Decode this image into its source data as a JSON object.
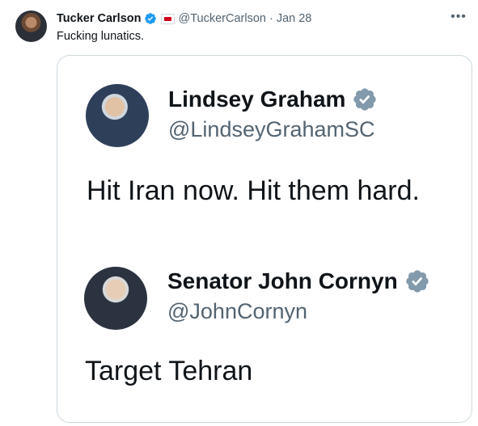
{
  "tweet": {
    "display_name": "Tucker Carlson",
    "handle": "@TuckerCarlson",
    "separator": "·",
    "date": "Jan 28",
    "text": "Fucking lunatics.",
    "more_icon": "more-icon",
    "verified_icon": "verified-badge-icon",
    "affiliate_icon": "affiliate-badge-icon"
  },
  "quoted": [
    {
      "display_name": "Lindsey Graham",
      "handle": "@LindseyGrahamSC",
      "text": "Hit Iran now. Hit them hard.",
      "badge": "gray-verified-icon"
    },
    {
      "display_name": "Senator John Cornyn",
      "handle": "@JohnCornyn",
      "text": "Target Tehran",
      "badge": "gray-verified-icon"
    }
  ],
  "colors": {
    "text": "#0f1419",
    "secondary": "#536471",
    "border": "#cfd9de",
    "verified_blue": "#1d9bf0",
    "verified_gray": "#829aab"
  }
}
